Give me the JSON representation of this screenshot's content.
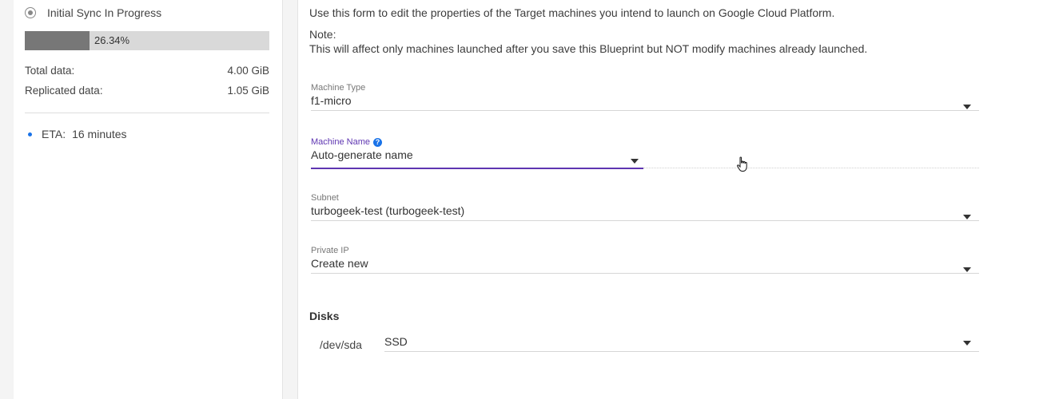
{
  "sidebar": {
    "sync_status": "Initial Sync In Progress",
    "progress": {
      "label": "26.34%",
      "fraction": 0.2634
    },
    "total_data": {
      "label": "Total data:",
      "value": "4.00 GiB"
    },
    "replicated_data": {
      "label": "Replicated data:",
      "value": "1.05 GiB"
    },
    "eta": {
      "label": "ETA:",
      "value": "16 minutes"
    }
  },
  "form": {
    "intro": "Use this form to edit the properties of the Target machines you intend to launch on Google Cloud Platform.",
    "note_title": "Note:",
    "note_text": "This will affect only machines launched after you save this Blueprint but NOT modify machines already launched.",
    "machine_type": {
      "label": "Machine Type",
      "value": "f1-micro"
    },
    "machine_name": {
      "label": "Machine Name",
      "value": "Auto-generate name"
    },
    "subnet": {
      "label": "Subnet",
      "value": "turbogeek-test (turbogeek-test)"
    },
    "private_ip": {
      "label": "Private IP",
      "value": "Create new"
    },
    "disks": {
      "title": "Disks",
      "items": [
        {
          "device": "/dev/sda",
          "type": "SSD"
        }
      ]
    }
  },
  "colors": {
    "accent": "#5e35b1",
    "progress_fill": "#777777",
    "progress_track": "#d9d9d9",
    "info": "#1a73e8"
  }
}
